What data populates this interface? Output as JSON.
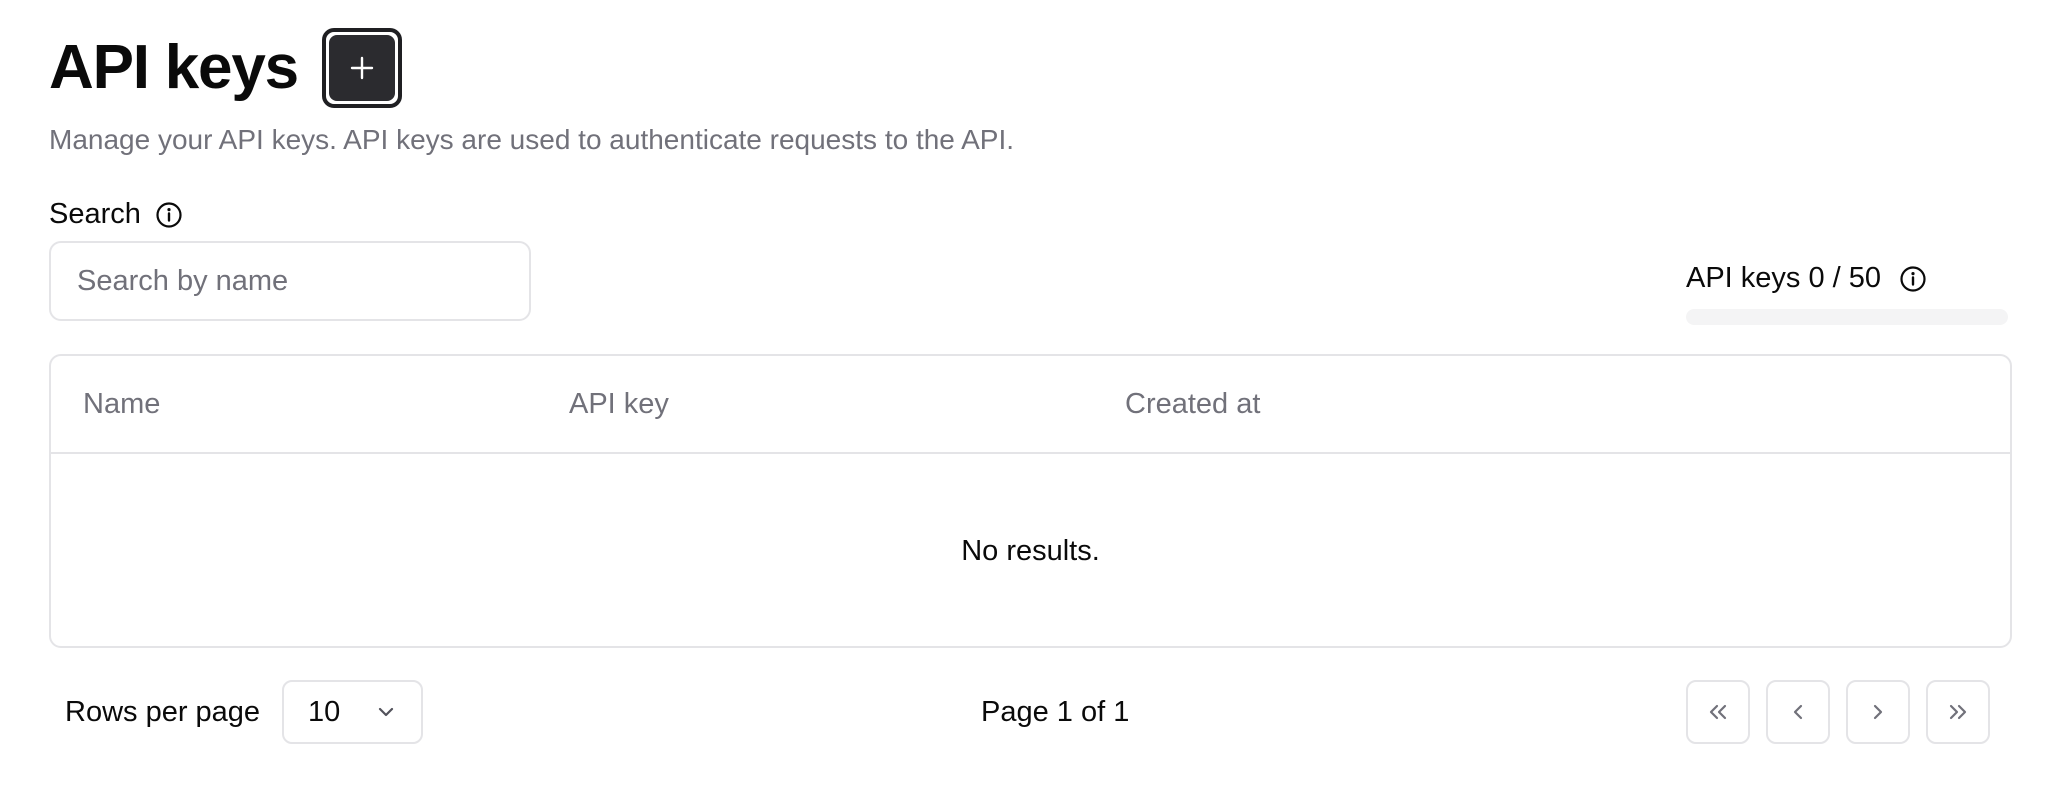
{
  "header": {
    "title": "API keys",
    "add_button_label": "+",
    "subtitle": "Manage your API keys. API keys are used to authenticate requests to the API."
  },
  "search": {
    "label": "Search",
    "placeholder": "Search by name",
    "value": ""
  },
  "usage": {
    "label": "API keys 0 / 50",
    "used": 0,
    "limit": 50,
    "fraction": 0
  },
  "table": {
    "columns": [
      "Name",
      "API key",
      "Created at"
    ],
    "rows": [],
    "empty_message": "No results."
  },
  "pagination": {
    "rows_per_page_label": "Rows per page",
    "rows_per_page_value": "10",
    "page_info": "Page 1 of 1"
  },
  "icons": {
    "info": "info-icon",
    "plus": "plus-icon",
    "chevron_down": "chevron-down-icon",
    "first_page": "chevrons-left-icon",
    "prev_page": "chevron-left-icon",
    "next_page": "chevron-right-icon",
    "last_page": "chevrons-right-icon"
  },
  "colors": {
    "primary": "#2b2b2f",
    "muted_text": "#71717a",
    "border": "#e4e4e7",
    "track": "#f4f4f5"
  }
}
